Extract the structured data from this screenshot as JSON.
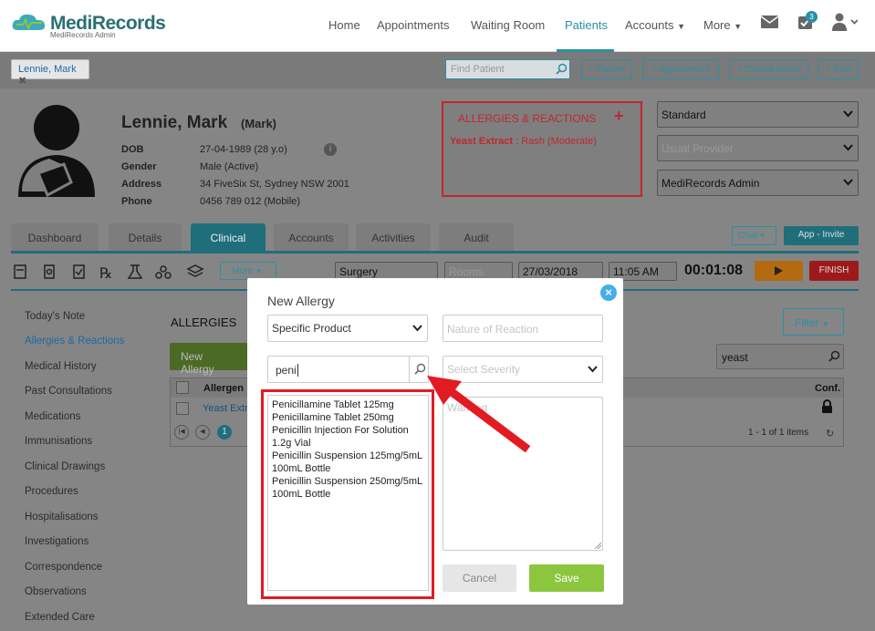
{
  "app": {
    "logo": "MediRecords",
    "logo_sub": "MediRecords Admin"
  },
  "nav": {
    "home": "Home",
    "appointments": "Appointments",
    "waiting_room": "Waiting Room",
    "patients": "Patients",
    "accounts": "Accounts",
    "more": "More",
    "badge": "3"
  },
  "toolbar": {
    "patient_chip": "Lennie, Mark",
    "find_placeholder": "Find Patient",
    "add_patient": "+ Patient",
    "add_appointment": "+ Appointment",
    "add_clinical": "+ Clinical Action",
    "add_task": "+ Task"
  },
  "patient": {
    "name": "Lennie, Mark",
    "nickname": "(Mark)",
    "dob_label": "DOB",
    "dob": "27-04-1989 (28 y.o)",
    "gender_label": "Gender",
    "gender": "Male (Active)",
    "address_label": "Address",
    "address": "34 FiveSix St, Sydney NSW 2001",
    "phone_label": "Phone",
    "phone": "0456 789 012 (Mobile)"
  },
  "allergy_panel": {
    "title": "ALLERGIES & REACTIONS",
    "allergen": "Yeast Extract",
    "reaction": " : Rash (Moderate)"
  },
  "selects": {
    "standard": "Standard",
    "usual_provider": "Usual Provider",
    "admin": "MediRecords Admin"
  },
  "tabs": [
    "Dashboard",
    "Details",
    "Clinical",
    "Accounts",
    "Activities",
    "Audit"
  ],
  "header_buttons": {
    "chat": "Chat",
    "app_invite": "App - Invite"
  },
  "clinical_bar": {
    "more": "More",
    "location": "Surgery",
    "rooms": "Rooms",
    "date": "27/03/2018",
    "time": "11:05 AM",
    "timer": "00:01:08",
    "finish": "FINISH"
  },
  "left_menu": [
    "Today's Note",
    "Allergies & Reactions",
    "Medical History",
    "Past Consultations",
    "Medications",
    "Immunisations",
    "Clinical Drawings",
    "Procedures",
    "Hospitalisations",
    "Investigations",
    "Correspondence",
    "Observations",
    "Extended Care"
  ],
  "allergies_section": {
    "title": "ALLERGIES",
    "new_btn": "New Allergy",
    "filter_btn": "Filter",
    "search_value": "yeast",
    "col_allergen": "Allergen",
    "col_conf": "Conf.",
    "row_allergen": "Yeast Extra",
    "items": "1 - 1 of 1 items",
    "page": "1"
  },
  "modal": {
    "title": "New Allergy",
    "type_value": "Specific Product",
    "nature_placeholder": "Nature of Reaction",
    "search_value": "peni",
    "severity_placeholder": "Select Severity",
    "warning_placeholder": "Warning",
    "results": [
      "Penicillamine Tablet 125mg",
      "Penicillamine Tablet 250mg",
      "Penicillin Injection For Solution 1.2g Vial",
      "Penicillin Suspension 125mg/5mL 100mL Bottle",
      "Penicillin Suspension 250mg/5mL 100mL Bottle"
    ],
    "cancel": "Cancel",
    "save": "Save"
  },
  "colors": {
    "accent": "#2a8fa6",
    "alert_red": "#e21b23",
    "save_green": "#8cc63f",
    "modal_close": "#44aee6"
  }
}
